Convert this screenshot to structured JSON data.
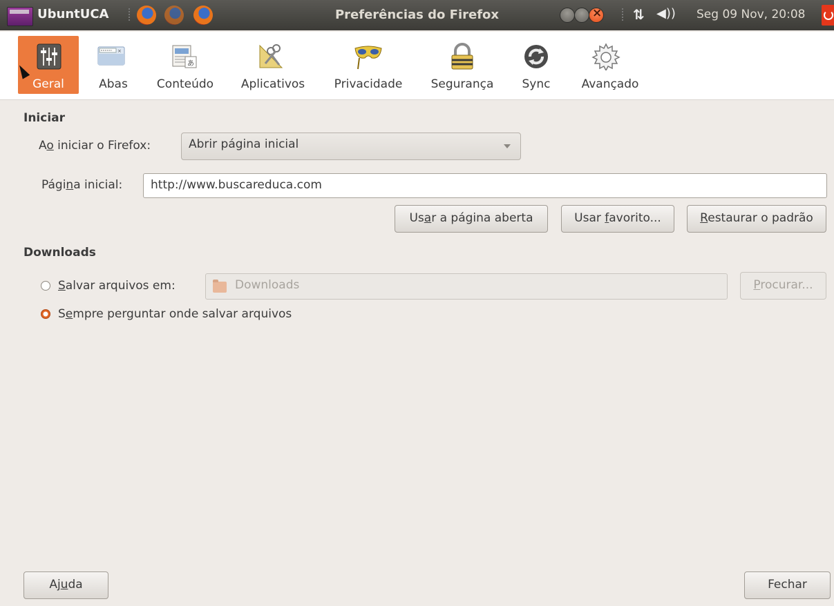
{
  "panel": {
    "app_name": "UbuntUCA",
    "window_title": "Preferências do Firefox",
    "clock": "Seg 09 Nov, 20:08"
  },
  "toolbar": {
    "items": [
      {
        "label": "Geral",
        "icon": "general-sliders-icon",
        "selected": true
      },
      {
        "label": "Abas",
        "icon": "tabs-icon"
      },
      {
        "label": "Conteúdo",
        "icon": "content-icon"
      },
      {
        "label": "Aplicativos",
        "icon": "applications-icon"
      },
      {
        "label": "Privacidade",
        "icon": "privacy-mask-icon"
      },
      {
        "label": "Segurança",
        "icon": "security-lock-icon"
      },
      {
        "label": "Sync",
        "icon": "sync-icon"
      },
      {
        "label": "Avançado",
        "icon": "advanced-gear-icon"
      }
    ]
  },
  "startup": {
    "heading": "Iniciar",
    "when_start_label_pre": "A",
    "when_start_label_ul": "o",
    "when_start_label_post": " iniciar o Firefox:",
    "when_start_value": "Abrir página inicial",
    "homepage_label_pre": "Pági",
    "homepage_label_ul": "n",
    "homepage_label_post": "a inicial:",
    "homepage_value": "http://www.buscareduca.com",
    "btn_current_pre": "Us",
    "btn_current_ul": "a",
    "btn_current_post": "r a página aberta",
    "btn_bookmark_pre": "Usar ",
    "btn_bookmark_ul": "f",
    "btn_bookmark_post": "avorito...",
    "btn_restore_pre": "",
    "btn_restore_ul": "R",
    "btn_restore_post": "estaurar o padrão"
  },
  "downloads": {
    "heading": "Downloads",
    "save_to_pre": "",
    "save_to_ul": "S",
    "save_to_post": "alvar arquivos em:",
    "folder": "Downloads",
    "browse_pre": "",
    "browse_ul": "P",
    "browse_post": "rocurar...",
    "always_ask_pre": "S",
    "always_ask_ul": "e",
    "always_ask_post": "mpre perguntar onde salvar arquivos",
    "selected_option": "always_ask"
  },
  "footer": {
    "help_pre": "Aj",
    "help_ul": "u",
    "help_post": "da",
    "close": "Fechar"
  },
  "colors": {
    "selected_tab": "#ec7a3d",
    "panel": "#3c3b37",
    "radio_active": "#e06423"
  }
}
